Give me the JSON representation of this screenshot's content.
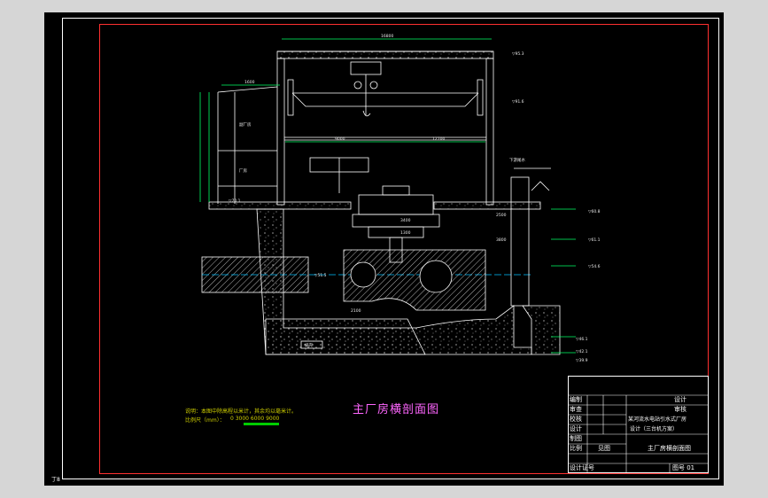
{
  "drawing": {
    "title": "主厂房横剖面图",
    "note_line1": "说明：本图中除高程以米计，其余均以毫米计。",
    "note_line2": "比例尺（mm）：",
    "scale_values": "0   3000  6000  9000",
    "corner_mark": "丁8",
    "elevation_labels": [
      "▽95.3",
      "▽91.6",
      "▽70.1",
      "▽60.8",
      "▽61.1",
      "▽54.6",
      "▽51.5",
      "▽46.1",
      "▽42.1",
      "▽39.9"
    ],
    "dimension_labels": [
      "16800",
      "1600",
      "9000",
      "12700",
      "3400",
      "1300",
      "2100",
      "2500",
      "3800"
    ],
    "area_labels": [
      "副厂房",
      "厂房",
      "下游尾水",
      "蜗壳"
    ]
  },
  "title_block": {
    "rows": [
      {
        "left": "编制",
        "right": "设计"
      },
      {
        "left": "审查",
        "right": "审核"
      },
      {
        "left": "校核",
        "right": "某河流水电站引水式厂房"
      },
      {
        "left": "设计",
        "right": "设计（三台机方案）"
      },
      {
        "left": "制图",
        "right": ""
      },
      {
        "left": "比例",
        "mid": "见图",
        "right": "主厂房横剖面图"
      },
      {
        "left": "设计证号",
        "mid": "",
        "right": "图号  01"
      }
    ]
  },
  "colors": {
    "background": "#000000",
    "frame_outer": "#ffffff",
    "frame_inner": "#ff3030",
    "dimension": "#00ff66",
    "concrete": "#ffffff",
    "title": "#ff66ff",
    "note": "#cfcf00",
    "axis": "#00bfff"
  }
}
